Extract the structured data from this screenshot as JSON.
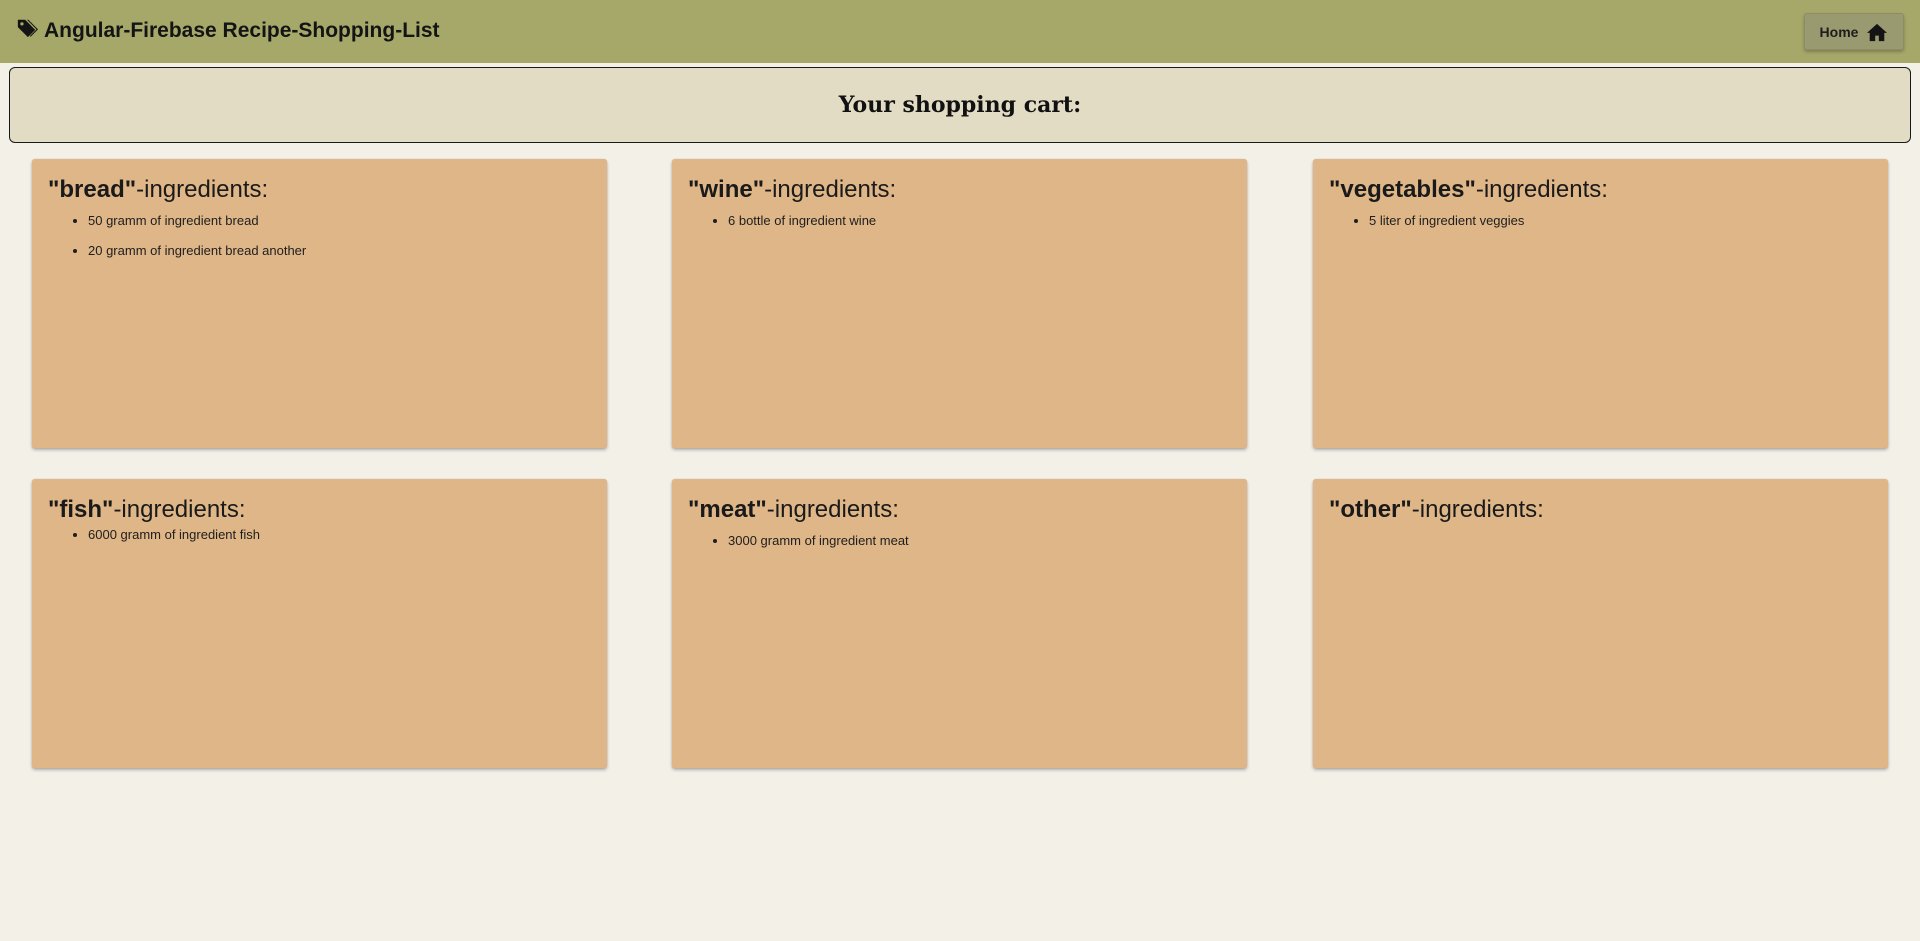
{
  "app": {
    "title": "Angular-Firebase Recipe-Shopping-List",
    "brand_icon": "tag-icon"
  },
  "nav": {
    "home_label": "Home",
    "home_icon": "home-icon"
  },
  "cart": {
    "title": "Your shopping cart:"
  },
  "categories": [
    {
      "name": "\"bread\"",
      "suffix": "-ingredients:",
      "items": [
        "50 gramm of ingredient bread",
        "20 gramm of ingredient bread another"
      ]
    },
    {
      "name": "\"wine\"",
      "suffix": "-ingredients:",
      "items": [
        "6 bottle of ingredient wine"
      ]
    },
    {
      "name": "\"vegetables\"",
      "suffix": "-ingredients:",
      "items": [
        "5 liter of ingredient veggies"
      ]
    },
    {
      "name": "\"fish\"",
      "suffix": "-ingredients:",
      "items": [
        "6000 gramm of ingredient fish"
      ]
    },
    {
      "name": "\"meat\"",
      "suffix": "-ingredients:",
      "items": [
        "3000 gramm of ingredient meat"
      ]
    },
    {
      "name": "\"other\"",
      "suffix": "-ingredients:",
      "items": []
    }
  ],
  "colors": {
    "toolbar": "#a6a86a",
    "page_background": "#f3f0e8",
    "cart_header": "#e3dcc4",
    "card": "#dfb687"
  }
}
